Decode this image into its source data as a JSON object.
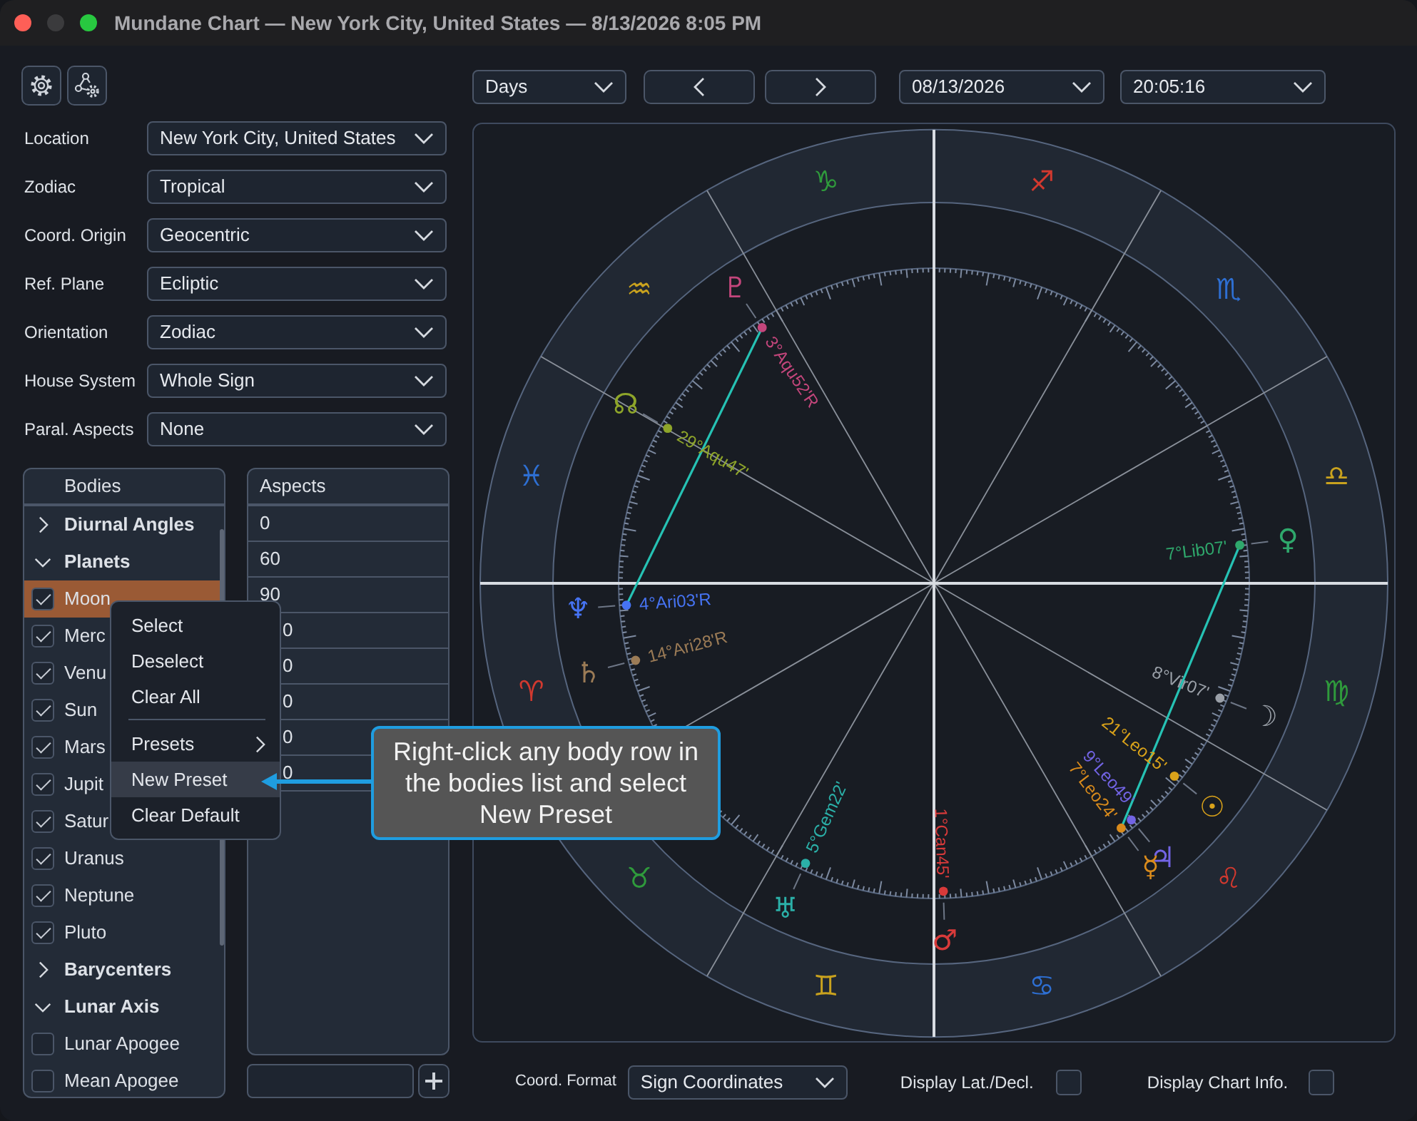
{
  "window": {
    "title": "Mundane Chart — New York City, United States — 8/13/2026 8:05 PM"
  },
  "settings": [
    {
      "label": "Location",
      "value": "New York City, United States"
    },
    {
      "label": "Zodiac",
      "value": "Tropical"
    },
    {
      "label": "Coord. Origin",
      "value": "Geocentric"
    },
    {
      "label": "Ref. Plane",
      "value": "Ecliptic"
    },
    {
      "label": "Orientation",
      "value": "Zodiac"
    },
    {
      "label": "House System",
      "value": "Whole Sign"
    },
    {
      "label": "Paral. Aspects",
      "value": "None"
    }
  ],
  "bodies": {
    "header": "Bodies",
    "items": [
      {
        "kind": "group",
        "label": "Diurnal Angles",
        "expanded": false
      },
      {
        "kind": "group",
        "label": "Planets",
        "expanded": true,
        "children": [
          {
            "kind": "body",
            "label": "Moon",
            "checked": true,
            "selected": true
          },
          {
            "kind": "body",
            "label": "Merc",
            "checked": true,
            "selected": false
          },
          {
            "kind": "body",
            "label": "Venu",
            "checked": true,
            "selected": false
          },
          {
            "kind": "body",
            "label": "Sun",
            "checked": true,
            "selected": false
          },
          {
            "kind": "body",
            "label": "Mars",
            "checked": true,
            "selected": false
          },
          {
            "kind": "body",
            "label": "Jupit",
            "checked": true,
            "selected": false
          },
          {
            "kind": "body",
            "label": "Satur",
            "checked": true,
            "selected": false
          },
          {
            "kind": "body",
            "label": "Uranus",
            "checked": true,
            "selected": false
          },
          {
            "kind": "body",
            "label": "Neptune",
            "checked": true,
            "selected": false
          },
          {
            "kind": "body",
            "label": "Pluto",
            "checked": true,
            "selected": false
          }
        ]
      },
      {
        "kind": "group",
        "label": "Barycenters",
        "expanded": false
      },
      {
        "kind": "group",
        "label": "Lunar Axis",
        "expanded": true,
        "children": [
          {
            "kind": "body",
            "label": "Lunar Apogee",
            "checked": false,
            "selected": false
          },
          {
            "kind": "body",
            "label": "Mean Apogee",
            "checked": false,
            "selected": false
          }
        ]
      }
    ]
  },
  "aspects": {
    "header": "Aspects",
    "rows": [
      {
        "value": "0",
        "covered": false
      },
      {
        "value": "60",
        "covered": false
      },
      {
        "value": "90",
        "covered": false
      },
      {
        "value": "0",
        "covered": true
      },
      {
        "value": "0",
        "covered": true
      },
      {
        "value": "0",
        "covered": true
      },
      {
        "value": "0",
        "covered": true
      },
      {
        "value": "0",
        "covered": true
      }
    ]
  },
  "context_menu": {
    "items": [
      {
        "kind": "item",
        "label": "Select",
        "selected": false
      },
      {
        "kind": "item",
        "label": "Deselect",
        "selected": false
      },
      {
        "kind": "item",
        "label": "Clear All",
        "selected": false
      },
      {
        "kind": "separator"
      },
      {
        "kind": "submenu",
        "label": "Presets",
        "selected": false
      },
      {
        "kind": "item",
        "label": "New Preset",
        "selected": true
      },
      {
        "kind": "item",
        "label": "Clear Default",
        "selected": false
      }
    ]
  },
  "callout": {
    "text": "Right-click any body row in the bodies list and select New Preset"
  },
  "navigation": {
    "period": "Days",
    "date": "08/13/2026",
    "time": "20:05:16"
  },
  "chart": {
    "signs": [
      {
        "glyph": "♈",
        "color": "#d2392f"
      },
      {
        "glyph": "♉",
        "color": "#2f9a3c"
      },
      {
        "glyph": "♊",
        "color": "#c9a21e"
      },
      {
        "glyph": "♋",
        "color": "#2e6fd2"
      },
      {
        "glyph": "♌",
        "color": "#d2392f"
      },
      {
        "glyph": "♍",
        "color": "#2f9a3c"
      },
      {
        "glyph": "♎",
        "color": "#c9a21e"
      },
      {
        "glyph": "♏",
        "color": "#2e6fd2"
      },
      {
        "glyph": "♐",
        "color": "#d2392f"
      },
      {
        "glyph": "♑",
        "color": "#2f9a3c"
      },
      {
        "glyph": "♒",
        "color": "#c9a21e"
      },
      {
        "glyph": "♓",
        "color": "#2e6fd2"
      }
    ],
    "bodies": [
      {
        "glyph": "♇",
        "label": "3°Aqu52'R",
        "color": "#c4467c"
      },
      {
        "glyph": "☊",
        "label": "29°Aqu47'",
        "color": "#8ea52a"
      },
      {
        "glyph": "♆",
        "label": "4°Ari03'R",
        "color": "#4673f2"
      },
      {
        "glyph": "♄",
        "label": "14°Ari28'R",
        "color": "#9b7b56"
      },
      {
        "glyph": "♀",
        "label": "7°Lib07'",
        "color": "#2fa86c"
      },
      {
        "glyph": "☽",
        "label": "8°Vir07'",
        "color": "#9aa0a8"
      },
      {
        "glyph": "☉",
        "label": "21°Leo15'",
        "color": "#d9a21a"
      },
      {
        "glyph": "♃",
        "label": "9°Leo49'",
        "color": "#7264e4"
      },
      {
        "glyph": "☿",
        "label": "7°Leo24'",
        "color": "#d98b1c"
      },
      {
        "glyph": "♂",
        "label": "1°Can45'",
        "color": "#d83a3a"
      },
      {
        "glyph": "♅",
        "label": "5°Gem22'",
        "color": "#2bb0a8"
      }
    ]
  },
  "coord_format": {
    "label": "Coord. Format",
    "value": "Sign Coordinates"
  },
  "options": [
    {
      "label": "Display Lat./Decl.",
      "checked": false
    },
    {
      "label": "Display Chart Info.",
      "checked": false
    }
  ]
}
